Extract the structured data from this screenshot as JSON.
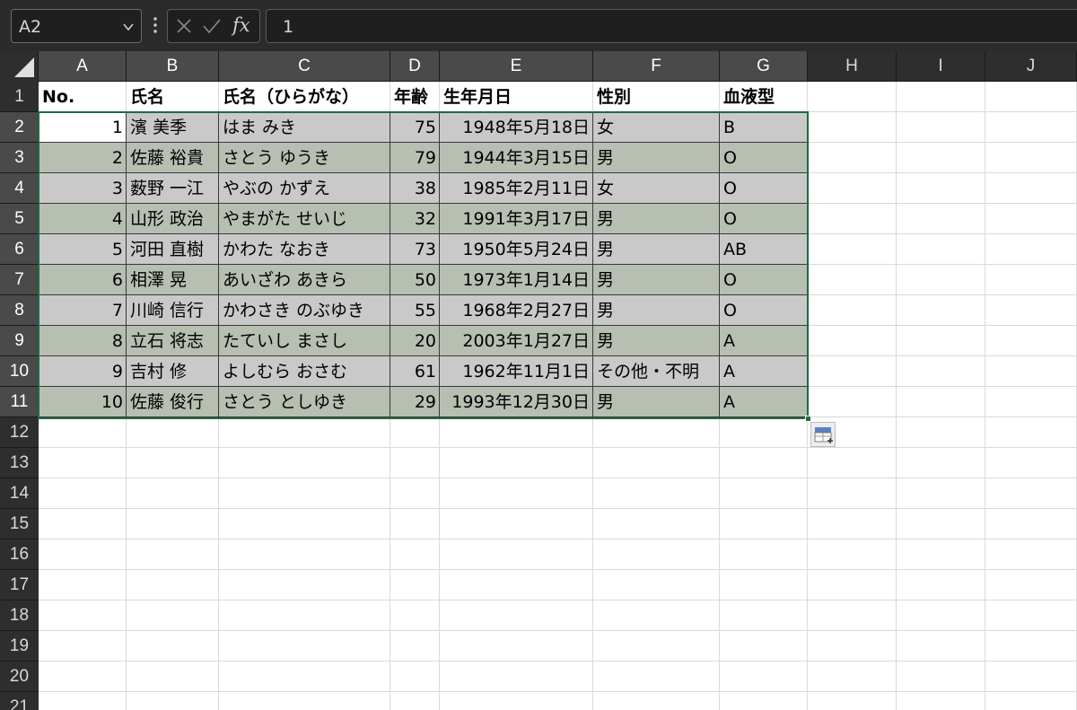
{
  "formula_bar": {
    "name_box": "A2",
    "name_box_icon": "chevron-down-icon",
    "more_icon": "vertical-ellipsis-icon",
    "cancel_icon": "cancel-x-icon",
    "enter_icon": "checkmark-icon",
    "fx_label": "fx",
    "formula_value": "1"
  },
  "columns": [
    "A",
    "B",
    "C",
    "D",
    "E",
    "F",
    "G",
    "H",
    "I",
    "J"
  ],
  "rows": [
    "1",
    "2",
    "3",
    "4",
    "5",
    "6",
    "7",
    "8",
    "9",
    "10",
    "11",
    "12",
    "13",
    "14",
    "15",
    "16",
    "17",
    "18",
    "19",
    "20",
    "21"
  ],
  "table": {
    "headers": [
      "No.",
      "氏名",
      "氏名（ひらがな）",
      "年齢",
      "生年月日",
      "性別",
      "血液型"
    ],
    "rows": [
      [
        "1",
        "濱 美季",
        "はま みき",
        "75",
        "1948年5月18日",
        "女",
        "B"
      ],
      [
        "2",
        "佐藤 裕貴",
        "さとう ゆうき",
        "79",
        "1944年3月15日",
        "男",
        "O"
      ],
      [
        "3",
        "薮野 一江",
        "やぶの かずえ",
        "38",
        "1985年2月11日",
        "女",
        "O"
      ],
      [
        "4",
        "山形 政治",
        "やまがた せいじ",
        "32",
        "1991年3月17日",
        "男",
        "O"
      ],
      [
        "5",
        "河田 直樹",
        "かわた なおき",
        "73",
        "1950年5月24日",
        "男",
        "AB"
      ],
      [
        "6",
        "相澤 晃",
        "あいざわ あきら",
        "50",
        "1973年1月14日",
        "男",
        "O"
      ],
      [
        "7",
        "川崎 信行",
        "かわさき のぶゆき",
        "55",
        "1968年2月27日",
        "男",
        "O"
      ],
      [
        "8",
        "立石 将志",
        "たていし まさし",
        "20",
        "2003年1月27日",
        "男",
        "A"
      ],
      [
        "9",
        "吉村 修",
        "よしむら おさむ",
        "61",
        "1962年11月1日",
        "その他・不明",
        "A"
      ],
      [
        "10",
        "佐藤 俊行",
        "さとう としゆき",
        "29",
        "1993年12月30日",
        "男",
        "A"
      ]
    ]
  },
  "selection": {
    "active_cell": "A2",
    "range": "A2:G11",
    "border_color": "#1e6b43"
  },
  "quick_analysis_icon": "quick-analysis-icon",
  "colors": {
    "band_odd": "#c9c9c9",
    "band_even": "#b6bfb1",
    "header_bg": "#2e2e2e",
    "formula_bar_bg": "#2b2b2b"
  }
}
